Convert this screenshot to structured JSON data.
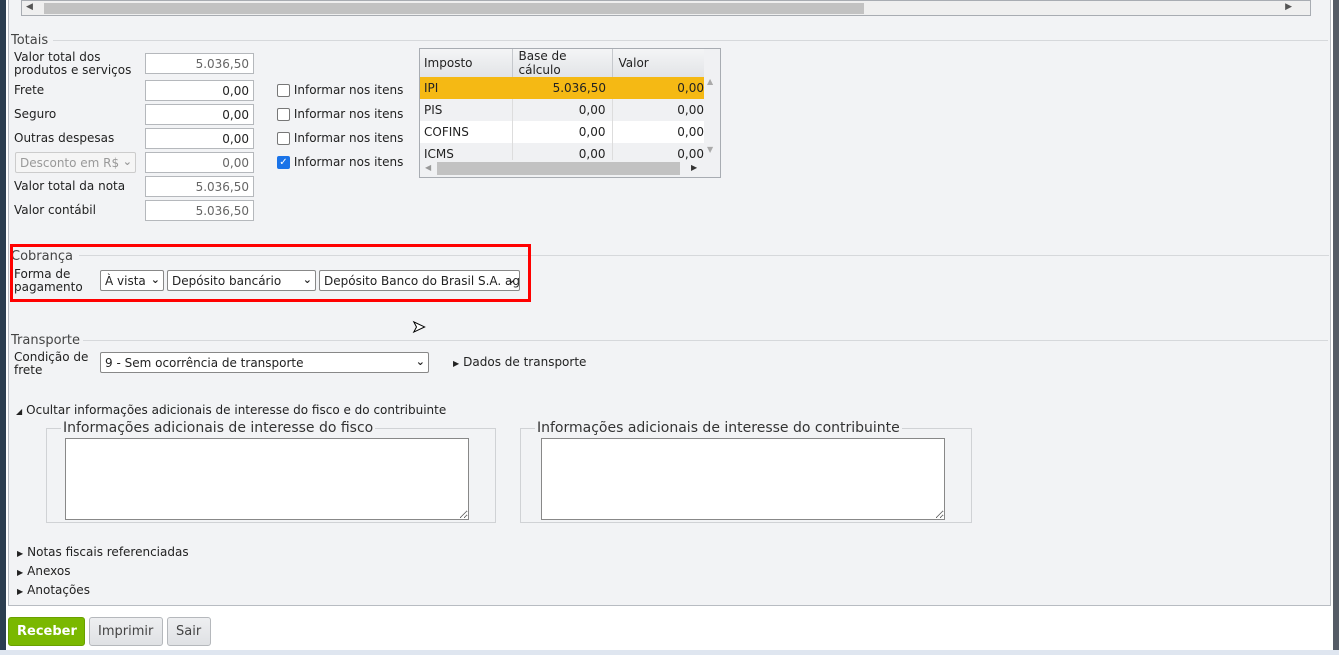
{
  "totais": {
    "title": "Totais",
    "valor_produtos_label": "Valor total dos produtos e serviços",
    "valor_produtos": "5.036,50",
    "frete_label": "Frete",
    "frete": "0,00",
    "seguro_label": "Seguro",
    "seguro": "0,00",
    "outras_label": "Outras despesas",
    "outras": "0,00",
    "desconto_select": "Desconto em R$",
    "desconto": "0,00",
    "valor_nota_label": "Valor total da nota",
    "valor_nota": "5.036,50",
    "valor_contabil_label": "Valor contábil",
    "valor_contabil": "5.036,50",
    "informar_label": "Informar nos itens",
    "checks": [
      false,
      false,
      false,
      true
    ]
  },
  "impostos": {
    "headers": [
      "Imposto",
      "Base de cálculo",
      "Valor"
    ],
    "rows": [
      [
        "IPI",
        "5.036,50",
        "0,00"
      ],
      [
        "PIS",
        "0,00",
        "0,00"
      ],
      [
        "COFINS",
        "0,00",
        "0,00"
      ],
      [
        "ICMS",
        "0,00",
        "0,00"
      ]
    ],
    "selected_color": "#f5b914"
  },
  "cobranca": {
    "title": "Cobrança",
    "forma_label": "Forma de pagamento",
    "prazo": "À vista",
    "tipo": "Depósito bancário",
    "conta": "Depósito Banco do Brasil S.A. ag"
  },
  "transporte": {
    "title": "Transporte",
    "condicao_label": "Condição de frete",
    "condicao": "9 - Sem ocorrência de transporte",
    "dados_link": "Dados de transporte"
  },
  "adicionais": {
    "toggle": "Ocultar informações adicionais de interesse do fisco e do contribuinte",
    "fisco_title": "Informações adicionais de interesse do fisco",
    "contribuinte_title": "Informações adicionais de interesse do contribuinte"
  },
  "expanders": [
    "Notas fiscais referenciadas",
    "Anexos",
    "Anotações"
  ],
  "buttons": {
    "receber": "Receber",
    "imprimir": "Imprimir",
    "sair": "Sair"
  }
}
